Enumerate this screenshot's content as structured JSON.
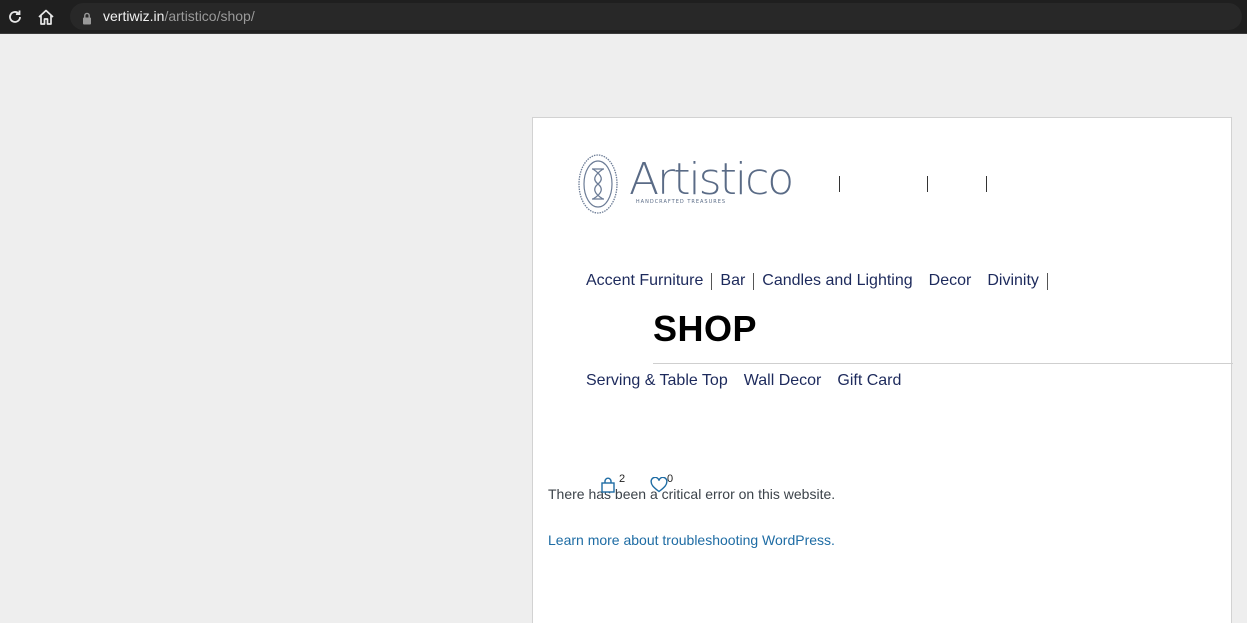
{
  "browser": {
    "url_host": "vertiwiz.in",
    "url_path": "/artistico/shop/",
    "icons": [
      "reload-icon",
      "home-icon",
      "lock-icon"
    ]
  },
  "site": {
    "logo_word": "Artistico",
    "logo_tagline": "HANDCRAFTED TREASURES",
    "nav_row1": [
      "Accent Furniture",
      "Bar",
      "Candles and Lighting",
      "Decor",
      "Divinity"
    ],
    "nav_row2": [
      "Serving & Table Top",
      "Wall Decor",
      "Gift Card"
    ],
    "page_title": "SHOP",
    "cart_count": "2",
    "wishlist_count": "0",
    "error_message": "There has been a critical error on this website.",
    "error_link": "Learn more about troubleshooting WordPress.",
    "colors": {
      "nav_text": "#1d2a5c",
      "link": "#1e6ca4",
      "logo": "#5a6b86",
      "icon_blue": "#1e6ca4"
    }
  }
}
